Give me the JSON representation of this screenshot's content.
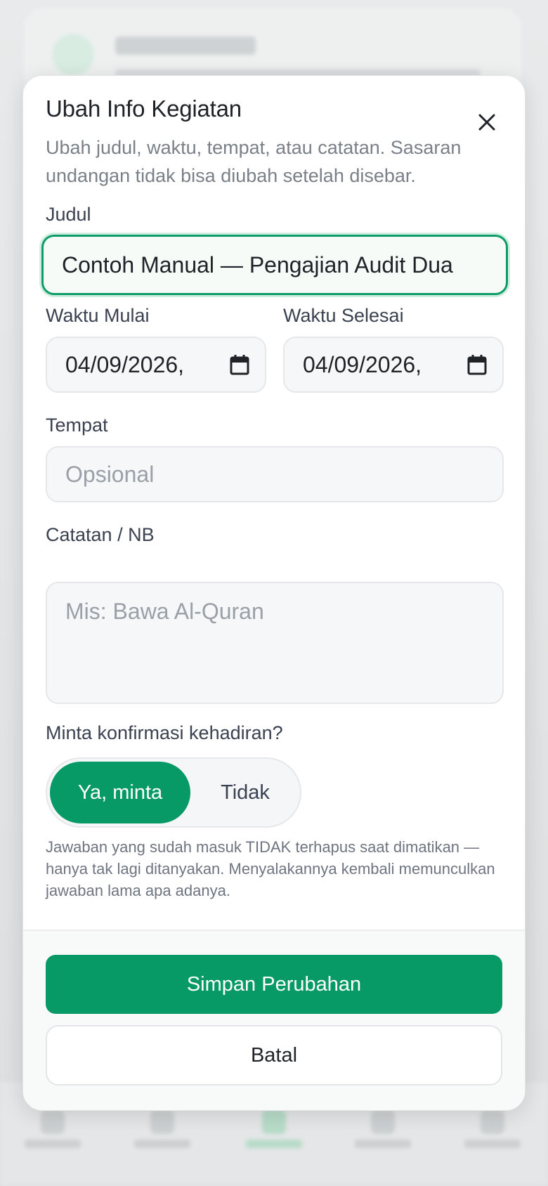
{
  "modal": {
    "title": "Ubah Info Kegiatan",
    "subtitle": "Ubah judul, waktu, tempat, atau catatan. Sasaran undangan tidak bisa diubah setelah disebar.",
    "close_icon": "close-icon"
  },
  "form": {
    "title_label": "Judul",
    "title_value": "Contoh Manual — Pengajian Audit Dua",
    "start_label": "Waktu Mulai",
    "start_value": "04/09/2026,",
    "end_label": "Waktu Selesai",
    "end_value": "04/09/2026,",
    "place_label": "Tempat",
    "place_placeholder": "Opsional",
    "notes_label": "Catatan / NB",
    "notes_placeholder": "Mis: Bawa Al-Quran",
    "rsvp_label": "Minta konfirmasi kehadiran?",
    "rsvp_yes": "Ya, minta",
    "rsvp_no": "Tidak",
    "rsvp_selected": "Ya, minta",
    "rsvp_note": "Jawaban yang sudah masuk TIDAK terhapus saat dimatikan — hanya tak lagi ditanyakan. Menyalakannya kembali memunculkan jawaban lama apa adanya."
  },
  "footer": {
    "save_label": "Simpan Perubahan",
    "cancel_label": "Batal"
  },
  "colors": {
    "accent": "#079a66",
    "focus_border": "#0e9d68"
  }
}
